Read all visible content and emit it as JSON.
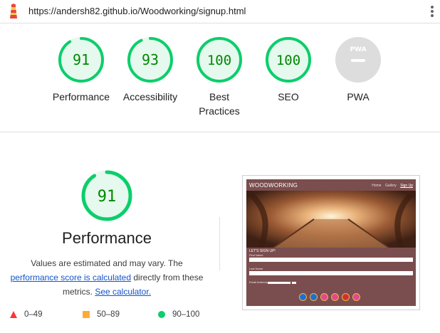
{
  "header": {
    "url": "https://andersh82.github.io/Woodworking/signup.html",
    "logo_icon": "lighthouse-icon",
    "menu_icon": "vertical-dots-icon"
  },
  "gauges": [
    {
      "score": "91",
      "score_value": 91,
      "label_line1": "Performance",
      "label_line2": "",
      "status": "pass"
    },
    {
      "score": "93",
      "score_value": 93,
      "label_line1": "Accessibility",
      "label_line2": "",
      "status": "pass"
    },
    {
      "score": "100",
      "score_value": 100,
      "label_line1": "Best",
      "label_line2": "Practices",
      "status": "pass"
    },
    {
      "score": "100",
      "score_value": 100,
      "label_line1": "SEO",
      "label_line2": "",
      "status": "pass"
    },
    {
      "score": "PWA",
      "label_line1": "PWA",
      "label_line2": "",
      "status": "na"
    }
  ],
  "performance": {
    "score": "91",
    "score_value": 91,
    "title": "Performance",
    "desc_part1": "Values are estimated and may vary. The",
    "desc_link1": "performance score is calculated",
    "desc_part2": " directly from these metrics. ",
    "desc_link2": "See calculator."
  },
  "legend": [
    {
      "range": "0–49",
      "shape": "triangle",
      "color": "#ff3333"
    },
    {
      "range": "50–89",
      "shape": "square",
      "color": "#ffaa33"
    },
    {
      "range": "90–100",
      "shape": "circle",
      "color": "#0cce6b"
    }
  ],
  "colors": {
    "pass": "#0cce6b",
    "pass_fill": "#e6f9ee",
    "pass_text": "#008800",
    "na": "#cccccc"
  },
  "thumbnail": {
    "brand": "WOODWORKING",
    "nav": [
      "Home",
      "Gallery",
      "Sign Up"
    ],
    "form_title": "LET'S SIGN UP!",
    "fields": [
      "First Name",
      "Last Name",
      "Email Address"
    ],
    "social_icons": [
      "linkedin-icon",
      "twitter-icon",
      "github-icon",
      "instagram-icon",
      "youtube-icon",
      "facebook-icon"
    ]
  }
}
